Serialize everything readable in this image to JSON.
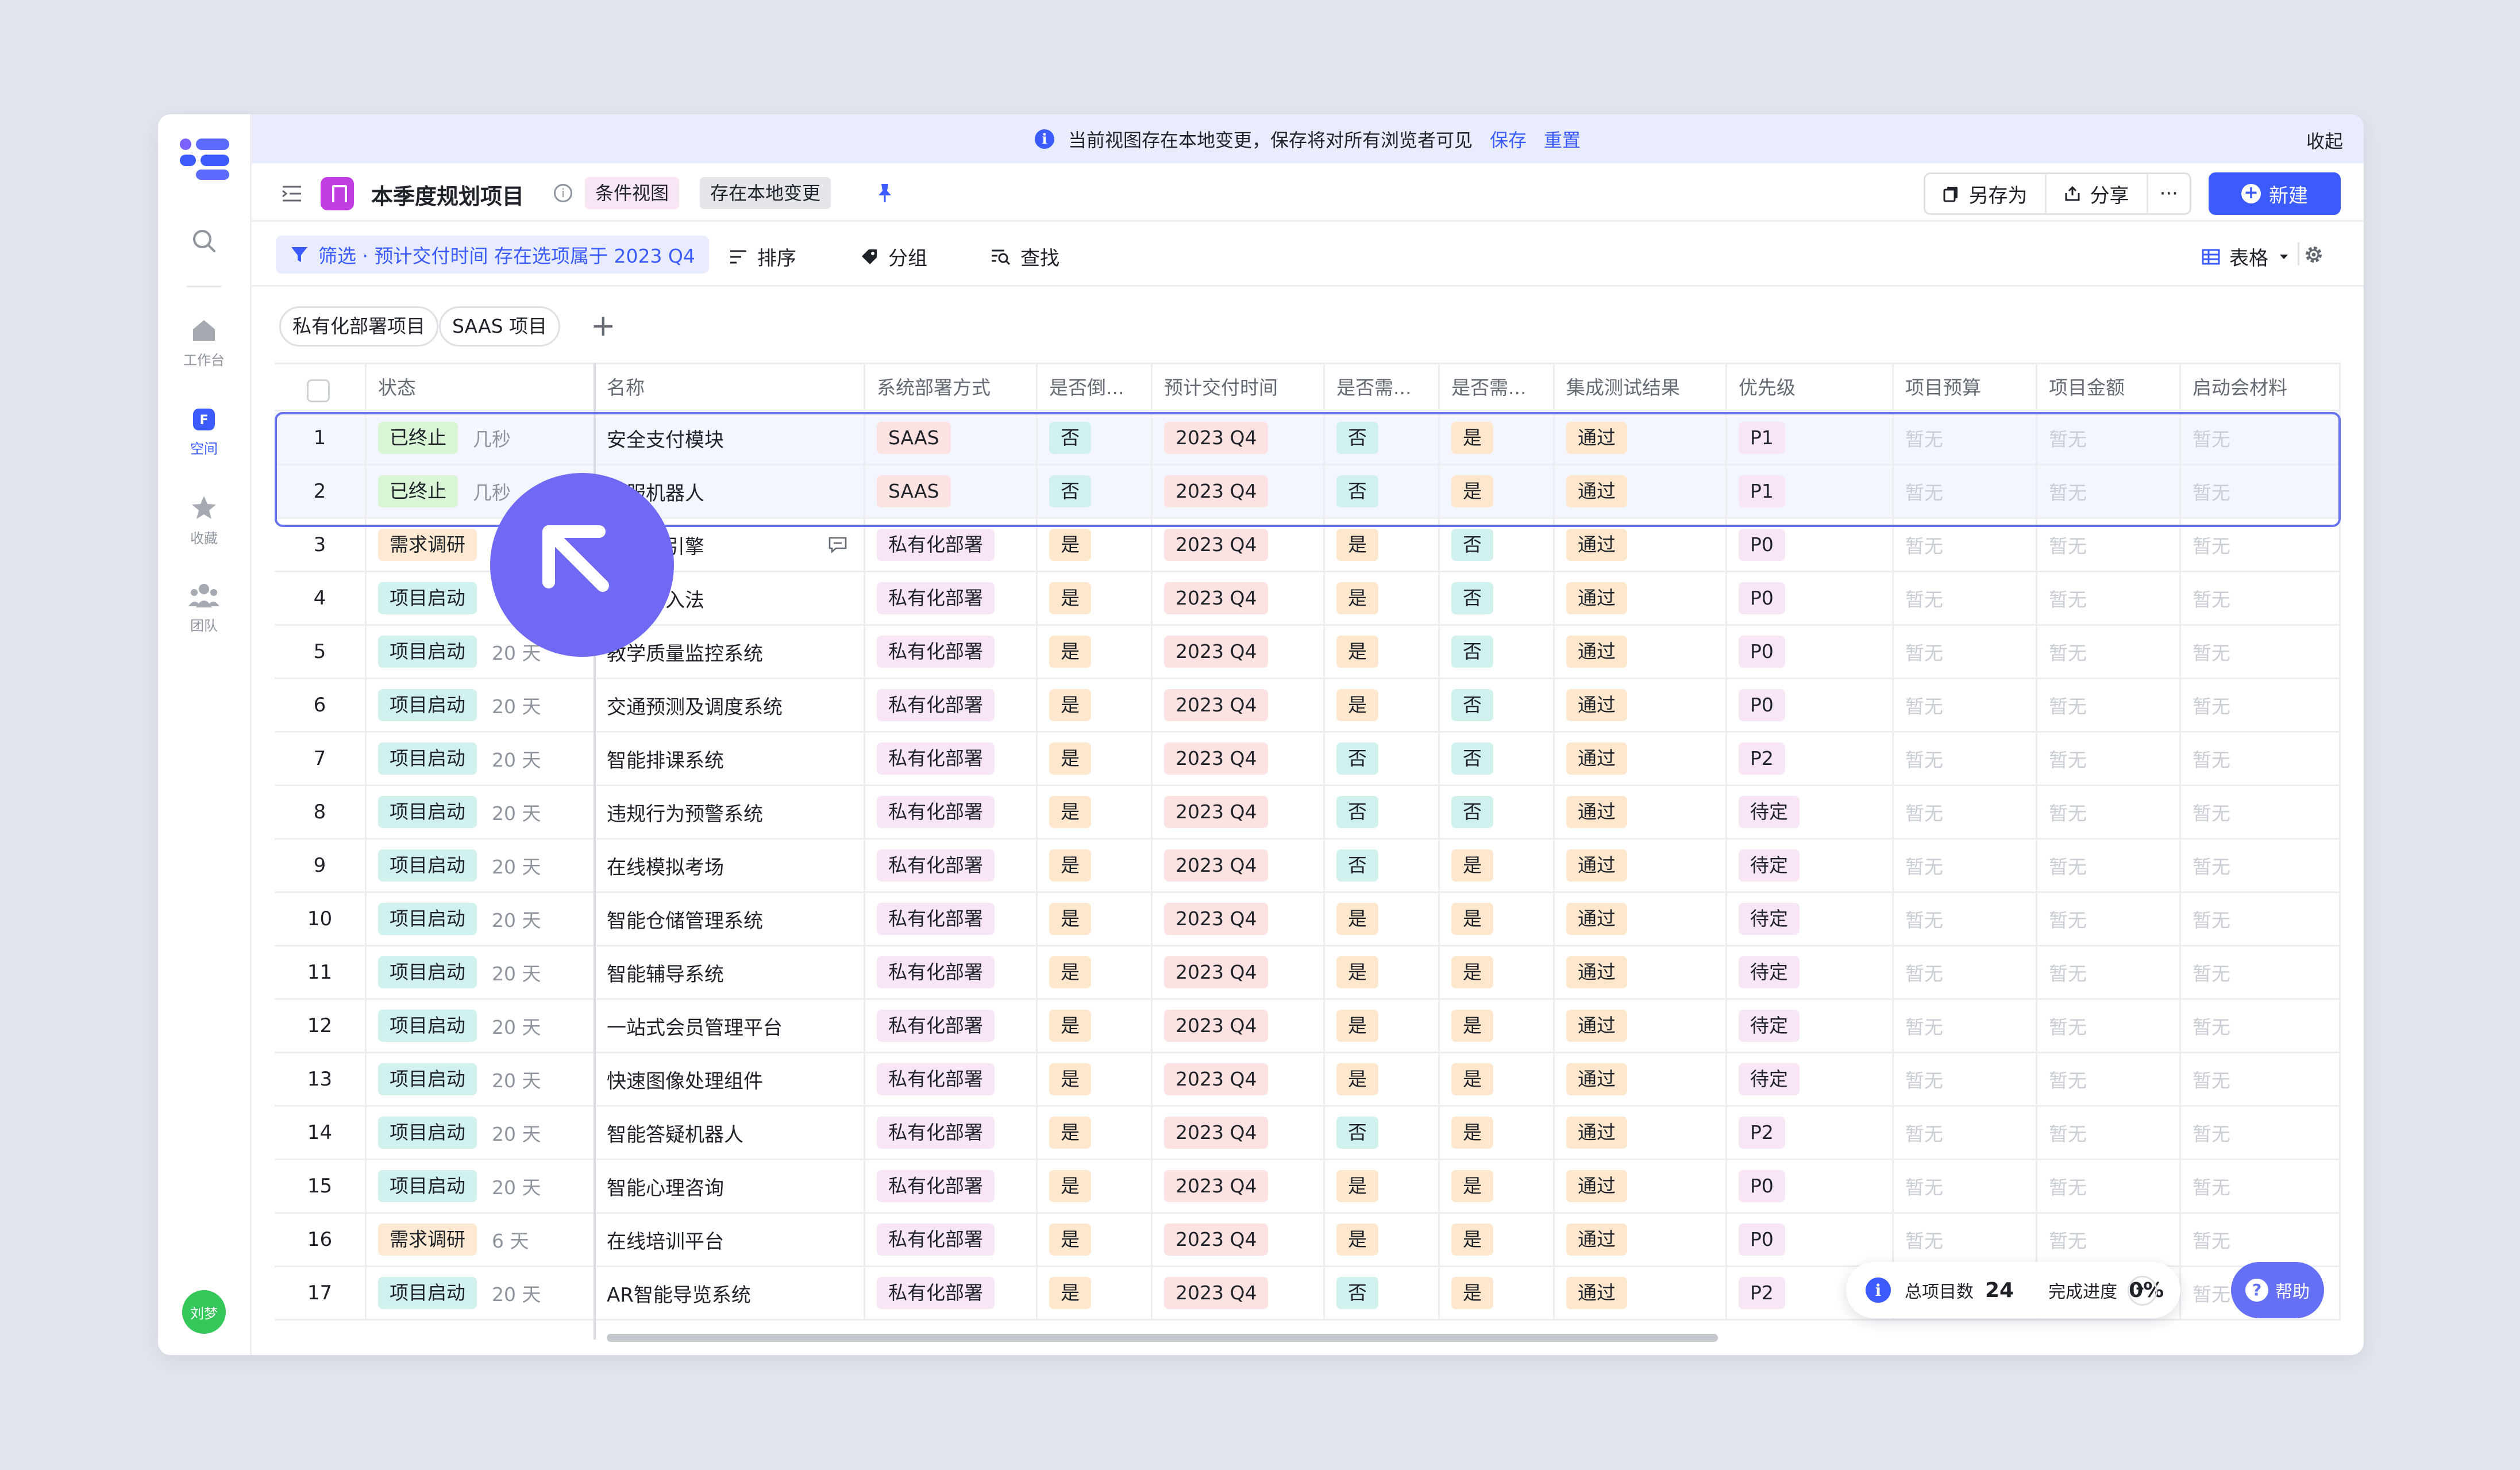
{
  "rail": {
    "items": [
      {
        "label": "工作台"
      },
      {
        "label": "空间"
      },
      {
        "label": "收藏"
      },
      {
        "label": "团队"
      }
    ],
    "avatar": "刘梦"
  },
  "banner": {
    "message": "当前视图存在本地变更，保存将对所有浏览者可见",
    "save": "保存",
    "reset": "重置",
    "collapse": "收起"
  },
  "header": {
    "title": "本季度规划项目",
    "chip_view": "条件视图",
    "chip_local": "存在本地变更",
    "save_as": "另存为",
    "share": "分享",
    "more": "···",
    "new": "新建"
  },
  "toolbar": {
    "filter": "筛选 · 预计交付时间 存在选项属于 2023 Q4",
    "sort": "排序",
    "group": "分组",
    "find": "查找",
    "view": "表格"
  },
  "views": {
    "tab1": "私有化部署项目",
    "tab2": "SAAS 项目"
  },
  "columns": {
    "status": "状态",
    "name": "名称",
    "deploy": "系统部署方式",
    "c4": "是否倒...",
    "delivery": "预计交付时间",
    "c6": "是否需...",
    "c7": "是否需...",
    "test": "集成测试结果",
    "priority": "优先级",
    "budget": "项目预算",
    "amount": "项目金额",
    "kickoff": "启动会材料"
  },
  "rows": [
    {
      "n": "1",
      "status": "已终止",
      "dur": "几秒",
      "name": "安全支付模块",
      "deploy": "SAAS",
      "c4": "否",
      "delivery": "2023 Q4",
      "c6": "否",
      "c7": "是",
      "test": "通过",
      "priority": "P1",
      "budget": "暂无",
      "amount": "暂无",
      "kickoff": "暂无"
    },
    {
      "n": "2",
      "status": "已终止",
      "dur": "几秒",
      "name": "客服机器人",
      "deploy": "SAAS",
      "c4": "否",
      "delivery": "2023 Q4",
      "c6": "否",
      "c7": "是",
      "test": "通过",
      "priority": "P1",
      "budget": "暂无",
      "amount": "暂无",
      "kickoff": "暂无"
    },
    {
      "n": "3",
      "status": "需求调研",
      "dur": "",
      "name": "销推荐引擎",
      "deploy": "私有化部署",
      "c4": "是",
      "delivery": "2023 Q4",
      "c6": "是",
      "c7": "否",
      "test": "通过",
      "priority": "P0",
      "budget": "暂无",
      "amount": "暂无",
      "kickoff": "暂无"
    },
    {
      "n": "4",
      "status": "项目启动",
      "dur": "",
      "name": "识别输入法",
      "deploy": "私有化部署",
      "c4": "是",
      "delivery": "2023 Q4",
      "c6": "是",
      "c7": "否",
      "test": "通过",
      "priority": "P0",
      "budget": "暂无",
      "amount": "暂无",
      "kickoff": "暂无"
    },
    {
      "n": "5",
      "status": "项目启动",
      "dur": "20 天",
      "name": "教学质量监控系统",
      "deploy": "私有化部署",
      "c4": "是",
      "delivery": "2023 Q4",
      "c6": "是",
      "c7": "否",
      "test": "通过",
      "priority": "P0",
      "budget": "暂无",
      "amount": "暂无",
      "kickoff": "暂无"
    },
    {
      "n": "6",
      "status": "项目启动",
      "dur": "20 天",
      "name": "交通预测及调度系统",
      "deploy": "私有化部署",
      "c4": "是",
      "delivery": "2023 Q4",
      "c6": "是",
      "c7": "否",
      "test": "通过",
      "priority": "P0",
      "budget": "暂无",
      "amount": "暂无",
      "kickoff": "暂无"
    },
    {
      "n": "7",
      "status": "项目启动",
      "dur": "20 天",
      "name": "智能排课系统",
      "deploy": "私有化部署",
      "c4": "是",
      "delivery": "2023 Q4",
      "c6": "否",
      "c7": "否",
      "test": "通过",
      "priority": "P2",
      "budget": "暂无",
      "amount": "暂无",
      "kickoff": "暂无"
    },
    {
      "n": "8",
      "status": "项目启动",
      "dur": "20 天",
      "name": "违规行为预警系统",
      "deploy": "私有化部署",
      "c4": "是",
      "delivery": "2023 Q4",
      "c6": "否",
      "c7": "否",
      "test": "通过",
      "priority": "待定",
      "budget": "暂无",
      "amount": "暂无",
      "kickoff": "暂无"
    },
    {
      "n": "9",
      "status": "项目启动",
      "dur": "20 天",
      "name": "在线模拟考场",
      "deploy": "私有化部署",
      "c4": "是",
      "delivery": "2023 Q4",
      "c6": "否",
      "c7": "是",
      "test": "通过",
      "priority": "待定",
      "budget": "暂无",
      "amount": "暂无",
      "kickoff": "暂无"
    },
    {
      "n": "10",
      "status": "项目启动",
      "dur": "20 天",
      "name": "智能仓储管理系统",
      "deploy": "私有化部署",
      "c4": "是",
      "delivery": "2023 Q4",
      "c6": "是",
      "c7": "是",
      "test": "通过",
      "priority": "待定",
      "budget": "暂无",
      "amount": "暂无",
      "kickoff": "暂无"
    },
    {
      "n": "11",
      "status": "项目启动",
      "dur": "20 天",
      "name": "智能辅导系统",
      "deploy": "私有化部署",
      "c4": "是",
      "delivery": "2023 Q4",
      "c6": "是",
      "c7": "是",
      "test": "通过",
      "priority": "待定",
      "budget": "暂无",
      "amount": "暂无",
      "kickoff": "暂无"
    },
    {
      "n": "12",
      "status": "项目启动",
      "dur": "20 天",
      "name": "一站式会员管理平台",
      "deploy": "私有化部署",
      "c4": "是",
      "delivery": "2023 Q4",
      "c6": "是",
      "c7": "是",
      "test": "通过",
      "priority": "待定",
      "budget": "暂无",
      "amount": "暂无",
      "kickoff": "暂无"
    },
    {
      "n": "13",
      "status": "项目启动",
      "dur": "20 天",
      "name": "快速图像处理组件",
      "deploy": "私有化部署",
      "c4": "是",
      "delivery": "2023 Q4",
      "c6": "是",
      "c7": "是",
      "test": "通过",
      "priority": "待定",
      "budget": "暂无",
      "amount": "暂无",
      "kickoff": "暂无"
    },
    {
      "n": "14",
      "status": "项目启动",
      "dur": "20 天",
      "name": "智能答疑机器人",
      "deploy": "私有化部署",
      "c4": "是",
      "delivery": "2023 Q4",
      "c6": "否",
      "c7": "是",
      "test": "通过",
      "priority": "P2",
      "budget": "暂无",
      "amount": "暂无",
      "kickoff": "暂无"
    },
    {
      "n": "15",
      "status": "项目启动",
      "dur": "20 天",
      "name": "智能心理咨询",
      "deploy": "私有化部署",
      "c4": "是",
      "delivery": "2023 Q4",
      "c6": "是",
      "c7": "是",
      "test": "通过",
      "priority": "P0",
      "budget": "暂无",
      "amount": "暂无",
      "kickoff": "暂无"
    },
    {
      "n": "16",
      "status": "需求调研",
      "dur": "6 天",
      "name": "在线培训平台",
      "deploy": "私有化部署",
      "c4": "是",
      "delivery": "2023 Q4",
      "c6": "是",
      "c7": "是",
      "test": "通过",
      "priority": "P0",
      "budget": "暂无",
      "amount": "暂无",
      "kickoff": "暂无"
    },
    {
      "n": "17",
      "status": "项目启动",
      "dur": "20 天",
      "name": "AR智能导览系统",
      "deploy": "私有化部署",
      "c4": "是",
      "delivery": "2023 Q4",
      "c6": "否",
      "c7": "是",
      "test": "通过",
      "priority": "P2",
      "budget": "暂无",
      "amount": "暂无",
      "kickoff": "暂无"
    }
  ],
  "stats": {
    "total_label": "总项目数",
    "total": "24",
    "progress_label": "完成进度",
    "progress": "0%"
  },
  "help": "帮助",
  "colors": {
    "accent": "#3b5bfc",
    "status_stopped": "#d9f5d6",
    "status_research": "#feead2",
    "status_started": "#d1f1ef",
    "deploy_saas": "#fde2e2",
    "deploy_private": "#f8e6f7",
    "yes": "#fee7cd",
    "no": "#d1f1ef",
    "delivery": "#fde2e2",
    "test_pass": "#fee7cd",
    "priority": "#f8e6f7"
  }
}
